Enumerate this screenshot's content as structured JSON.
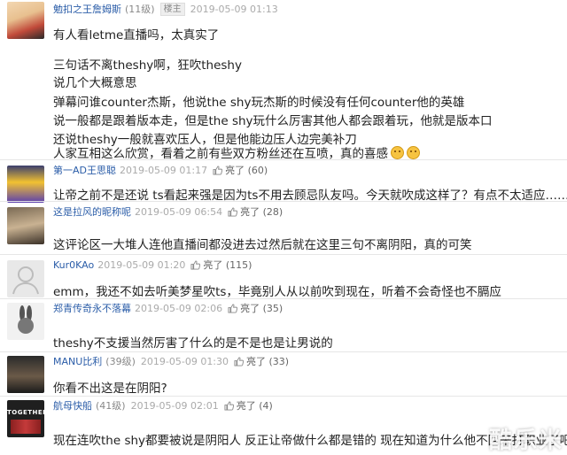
{
  "posts": [
    {
      "user": "勉扣之王詹姆斯",
      "level": "(11级)",
      "floor": "楼主",
      "time": "2019-05-09 01:13",
      "lines": [
        "有人看letme直播吗，太真实了",
        "三句话不离theshy啊，狂吹theshy",
        "说几个大概意思",
        "弹幕问谁counter杰斯，他说the shy玩杰斯的时候没有任何counter他的英雄",
        "说一般都是跟着版本走，但是the shy玩什么厉害其他人都会跟着玩，他就是版本口",
        "还说theshy一般就喜欢压人，但是他能边压人边完美补刀",
        "人家互相这么欣赏，看着之前有些双方粉丝还在互喷，真的喜感"
      ]
    },
    {
      "user": "第一AD王思聪",
      "time": "2019-05-09 01:17",
      "like": "亮了",
      "count": "(60)",
      "text": "让帝之前不是还说 ts看起来强是因为ts不用去顾忌队友吗。今天就吹成这样了？有点不太适应……"
    },
    {
      "user": "这是拉风的昵称呢",
      "time": "2019-05-09 06:54",
      "like": "亮了",
      "count": "(28)",
      "text": "这评论区一大堆人连他直播间都没进去过然后就在这里三句不离阴阳，真的可笑"
    },
    {
      "user": "Kur0KAo",
      "time": "2019-05-09 01:20",
      "like": "亮了",
      "count": "(115)",
      "text": "emm，我还不如去听美梦星吹ts，毕竟别人从以前吹到现在，听着不会奇怪也不膈应"
    },
    {
      "user": "郑青传奇永不落幕",
      "time": "2019-05-09 02:06",
      "like": "亮了",
      "count": "(35)",
      "text": "theshy不支援当然厉害了什么的是不是也是让男说的"
    },
    {
      "user": "MANU比利",
      "level": "(39级)",
      "time": "2019-05-09 01:30",
      "like": "亮了",
      "count": "(33)",
      "text": "你看不出这是在阴阳?"
    },
    {
      "user": "航母快船",
      "level": "(41级)",
      "time": "2019-05-09 02:01",
      "like": "亮了",
      "count": "(4)",
      "text": "现在连吹the shy都要被说是阴阳人 反正让帝做什么都是错的 现在知道为什么他不回来打职业了吧"
    }
  ],
  "watermark": "酷乐米",
  "avatar_banner": "TOGETHER"
}
